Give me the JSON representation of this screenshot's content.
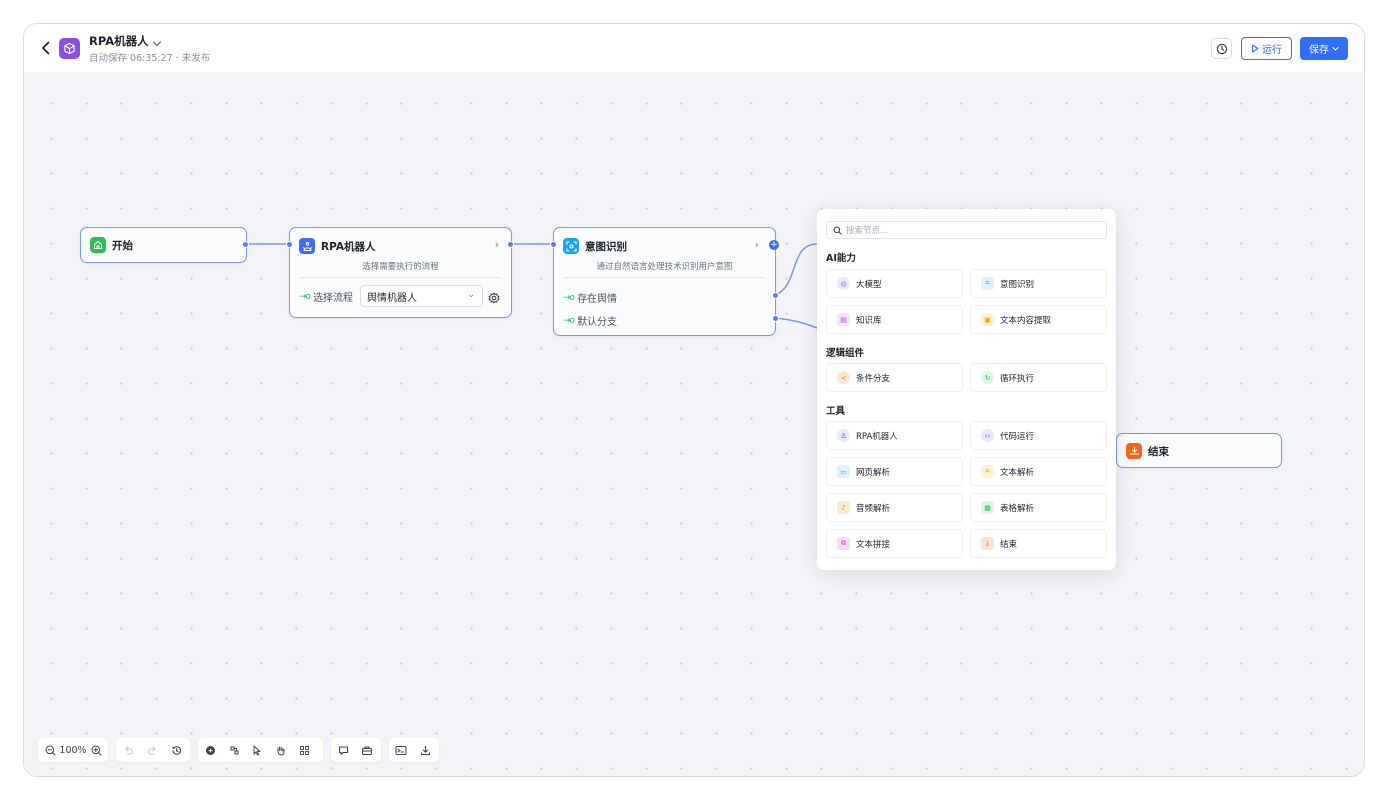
{
  "header": {
    "title": "RPA机器人",
    "subtitle": "自动保存 06:35:27 · 未发布",
    "run_label": "运行",
    "save_label": "保存"
  },
  "nodes": {
    "start": {
      "title": "开始"
    },
    "rpa": {
      "title": "RPA机器人",
      "description": "选择需要执行的流程",
      "field_label": "选择流程",
      "field_value": "舆情机器人"
    },
    "intent": {
      "title": "意图识别",
      "description": "通过自然语言处理技术识别用户意图",
      "branches": [
        "存在舆情",
        "默认分支"
      ]
    },
    "end": {
      "title": "结束"
    }
  },
  "panel": {
    "search_placeholder": "搜索节点...",
    "groups": [
      {
        "label": "AI能力",
        "items": [
          "大模型",
          "意图识别",
          "知识库",
          "文本内容提取"
        ]
      },
      {
        "label": "逻辑组件",
        "items": [
          "条件分支",
          "循环执行"
        ]
      },
      {
        "label": "工具",
        "items": [
          "RPA机器人",
          "代码运行",
          "网页解析",
          "文本解析",
          "音频解析",
          "表格解析",
          "文本拼接",
          "结束"
        ]
      }
    ]
  },
  "toolbar": {
    "zoom": "100%"
  },
  "colors": {
    "accent": "#2f6ff7",
    "node_border": "#7c97ee",
    "start_icon": "#2dbf55",
    "rpa_icon": "#3d6cf2",
    "intent_icon": "#1aa3f0",
    "end_icon": "#f06a1e",
    "app_icon": "#8a4fdc"
  }
}
